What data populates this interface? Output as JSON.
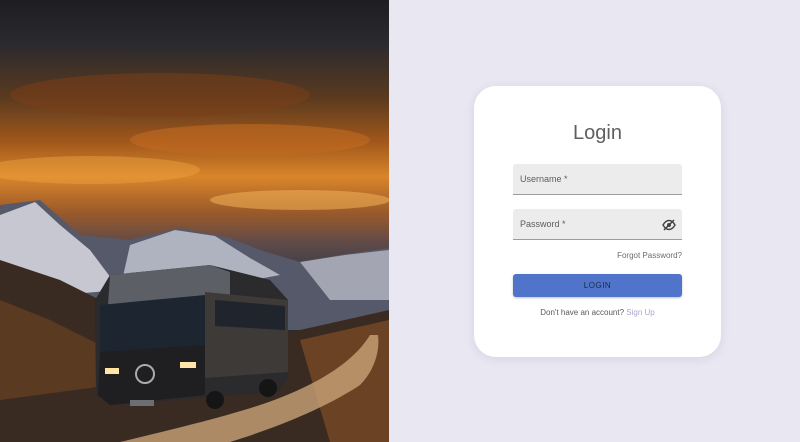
{
  "login": {
    "title": "Login",
    "username_label": "Username *",
    "password_label": "Password *",
    "password_toggle_icon": "eye-off-icon",
    "forgot_password": "Forgot Password?",
    "login_button": "LOGIN",
    "no_account_text": "Don't have an account?",
    "signup_link": "Sign Up"
  },
  "colors": {
    "page_background": "#e9e7f2",
    "card_background": "#ffffff",
    "button_primary": "#4f74c9",
    "signup_link": "#aaa5cf"
  }
}
